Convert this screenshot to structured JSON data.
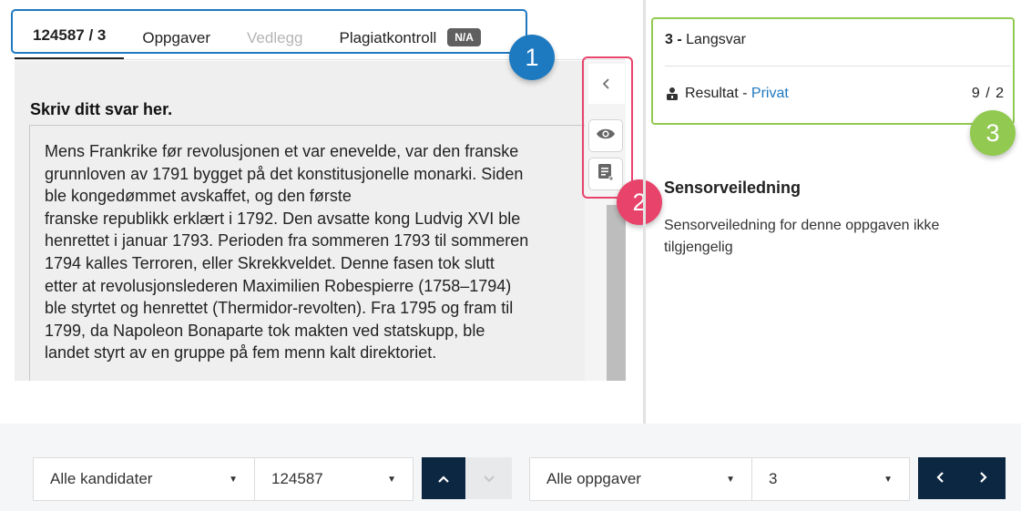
{
  "tabs": [
    {
      "label": "124587 / 3",
      "state": "active"
    },
    {
      "label": "Oppgaver",
      "state": "normal"
    },
    {
      "label": "Vedlegg",
      "state": "disabled"
    },
    {
      "label": "Plagiatkontroll",
      "state": "normal",
      "badge": "N/A"
    }
  ],
  "answer": {
    "title": "Skriv ditt svar her.",
    "text": "Mens Frankrike før revolusjonen et var enevelde, var den franske\ngrunnloven av 1791 bygget på det konstitusjonelle monarki. Siden\nble kongedømmet avskaffet, og den første\nfranske republikk erklært i 1792. Den avsatte kong Ludvig XVI ble\nhenrettet i januar 1793. Perioden fra sommeren 1793 til sommeren\n1794 kalles Terroren, eller Skrekkveldet. Denne fasen tok slutt\netter at revolusjonslederen Maximilien Robespierre (1758–1794)\nble styrtet og henrettet (Thermidor-revolten). Fra 1795 og fram til\n1799, da Napoleon Bonaparte tok makten ved statskupp, ble\nlandet styrt av en gruppe på fem menn kalt direktoriet."
  },
  "markers": [
    "1",
    "2",
    "3"
  ],
  "task": {
    "number": "3 -",
    "name": "Langsvar",
    "result_label": "Resultat -",
    "privacy_link": "Privat",
    "score": "9  /  2"
  },
  "guide": {
    "title": "Sensorveiledning",
    "text": "Sensorveiledning for denne oppgaven ikke tilgjengelig"
  },
  "bottom": {
    "candidate_filter": "Alle kandidater",
    "candidate_id": "124587",
    "task_filter": "Alle oppgaver",
    "task_number": "3"
  },
  "colors": {
    "tab_frame": "#1f78c0",
    "tool_frame": "#e8436b",
    "task_frame": "#92c950",
    "nav_dark": "#0c2742",
    "link": "#1f78c0"
  },
  "icons": [
    "chevron-left-icon",
    "eye-icon",
    "notes-icon",
    "lock-user-icon",
    "caret-down-icon",
    "chevron-up-icon",
    "chevron-down-icon",
    "chevron-right-icon"
  ]
}
